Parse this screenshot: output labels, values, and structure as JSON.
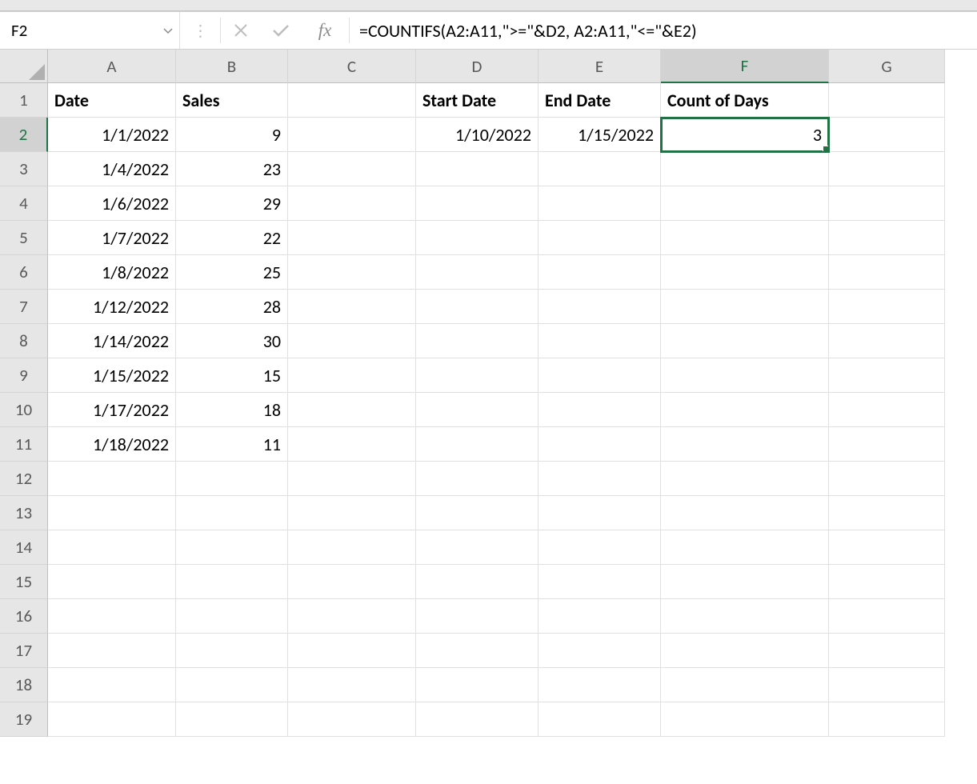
{
  "name_box": "F2",
  "formula": "=COUNTIFS(A2:A11,\">=\"&D2, A2:A11,\"<=\"&E2)",
  "fx_label": "fx",
  "columns": [
    "A",
    "B",
    "C",
    "D",
    "E",
    "F",
    "G"
  ],
  "row_numbers": [
    "1",
    "2",
    "3",
    "4",
    "5",
    "6",
    "7",
    "8",
    "9",
    "10",
    "11",
    "12",
    "13",
    "14",
    "15",
    "16",
    "17",
    "18",
    "19"
  ],
  "active_column": "F",
  "active_row": "2",
  "cells": {
    "r1": {
      "A": "Date",
      "B": "Sales",
      "C": "",
      "D": "Start Date",
      "E": "End Date",
      "F": "Count of Days",
      "G": ""
    },
    "r2": {
      "A": "1/1/2022",
      "B": "9",
      "C": "",
      "D": "1/10/2022",
      "E": "1/15/2022",
      "F": "3",
      "G": ""
    },
    "r3": {
      "A": "1/4/2022",
      "B": "23",
      "C": "",
      "D": "",
      "E": "",
      "F": "",
      "G": ""
    },
    "r4": {
      "A": "1/6/2022",
      "B": "29",
      "C": "",
      "D": "",
      "E": "",
      "F": "",
      "G": ""
    },
    "r5": {
      "A": "1/7/2022",
      "B": "22",
      "C": "",
      "D": "",
      "E": "",
      "F": "",
      "G": ""
    },
    "r6": {
      "A": "1/8/2022",
      "B": "25",
      "C": "",
      "D": "",
      "E": "",
      "F": "",
      "G": ""
    },
    "r7": {
      "A": "1/12/2022",
      "B": "28",
      "C": "",
      "D": "",
      "E": "",
      "F": "",
      "G": ""
    },
    "r8": {
      "A": "1/14/2022",
      "B": "30",
      "C": "",
      "D": "",
      "E": "",
      "F": "",
      "G": ""
    },
    "r9": {
      "A": "1/15/2022",
      "B": "15",
      "C": "",
      "D": "",
      "E": "",
      "F": "",
      "G": ""
    },
    "r10": {
      "A": "1/17/2022",
      "B": "18",
      "C": "",
      "D": "",
      "E": "",
      "F": "",
      "G": ""
    },
    "r11": {
      "A": "1/18/2022",
      "B": "11",
      "C": "",
      "D": "",
      "E": "",
      "F": "",
      "G": ""
    },
    "r12": {
      "A": "",
      "B": "",
      "C": "",
      "D": "",
      "E": "",
      "F": "",
      "G": ""
    },
    "r13": {
      "A": "",
      "B": "",
      "C": "",
      "D": "",
      "E": "",
      "F": "",
      "G": ""
    },
    "r14": {
      "A": "",
      "B": "",
      "C": "",
      "D": "",
      "E": "",
      "F": "",
      "G": ""
    },
    "r15": {
      "A": "",
      "B": "",
      "C": "",
      "D": "",
      "E": "",
      "F": "",
      "G": ""
    },
    "r16": {
      "A": "",
      "B": "",
      "C": "",
      "D": "",
      "E": "",
      "F": "",
      "G": ""
    },
    "r17": {
      "A": "",
      "B": "",
      "C": "",
      "D": "",
      "E": "",
      "F": "",
      "G": ""
    },
    "r18": {
      "A": "",
      "B": "",
      "C": "",
      "D": "",
      "E": "",
      "F": "",
      "G": ""
    },
    "r19": {
      "A": "",
      "B": "",
      "C": "",
      "D": "",
      "E": "",
      "F": "",
      "G": ""
    }
  }
}
